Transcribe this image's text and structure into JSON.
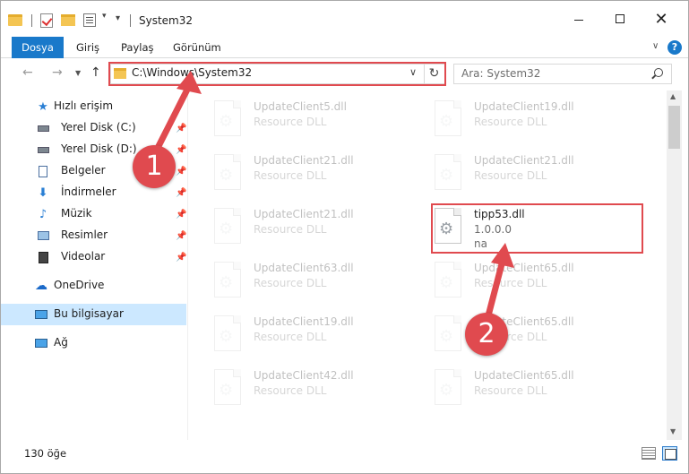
{
  "window": {
    "title": "System32",
    "controls": {
      "minimize": "",
      "maximize": "",
      "close": "✕"
    }
  },
  "ribbon": {
    "tabs": [
      "Dosya",
      "Giriş",
      "Paylaş",
      "Görünüm"
    ],
    "help": "?"
  },
  "address": {
    "path": "C:\\Windows\\System32",
    "search_placeholder": "Ara: System32"
  },
  "sidebar": {
    "items": [
      {
        "label": "Hızlı erişim",
        "icon": "star-icon",
        "pinned": false
      },
      {
        "label": "Yerel Disk (C:)",
        "icon": "drive-icon",
        "pinned": true
      },
      {
        "label": "Yerel Disk (D:)",
        "icon": "drive-icon",
        "pinned": true
      },
      {
        "label": "Belgeler",
        "icon": "document-icon",
        "pinned": true
      },
      {
        "label": "İndirmeler",
        "icon": "download-icon",
        "pinned": true
      },
      {
        "label": "Müzik",
        "icon": "music-icon",
        "pinned": true
      },
      {
        "label": "Resimler",
        "icon": "picture-icon",
        "pinned": true
      },
      {
        "label": "Videolar",
        "icon": "video-icon",
        "pinned": true
      },
      {
        "label": "OneDrive",
        "icon": "cloud-icon",
        "pinned": false
      },
      {
        "label": "Bu bilgisayar",
        "icon": "computer-icon",
        "pinned": false,
        "selected": true
      },
      {
        "label": "Ağ",
        "icon": "network-icon",
        "pinned": false
      }
    ]
  },
  "files": {
    "left": [
      {
        "name": "UpdateClient5.dll",
        "type": "Resource DLL"
      },
      {
        "name": "UpdateClient21.dll",
        "type": "Resource DLL"
      },
      {
        "name": "UpdateClient21.dll",
        "type": "Resource DLL"
      },
      {
        "name": "UpdateClient63.dll",
        "type": "Resource DLL"
      },
      {
        "name": "UpdateClient19.dll",
        "type": "Resource DLL"
      },
      {
        "name": "UpdateClient42.dll",
        "type": "Resource DLL"
      }
    ],
    "right": [
      {
        "name": "UpdateClient19.dll",
        "type": "Resource DLL"
      },
      {
        "name": "UpdateClient21.dll",
        "type": "Resource DLL"
      },
      {
        "name": "tipp53.dll",
        "type": "1.0.0.0",
        "version": "na",
        "highlighted": true
      },
      {
        "name": "UpdateClient65.dll",
        "type": "Resource DLL"
      },
      {
        "name": "UpdateClient65.dll",
        "type": "Resource DLL"
      },
      {
        "name": "UpdateClient65.dll",
        "type": "Resource DLL"
      }
    ]
  },
  "status": {
    "count": "130 öğe"
  },
  "annotations": {
    "step1": "1",
    "step2": "2",
    "color": "#e04a4f"
  }
}
